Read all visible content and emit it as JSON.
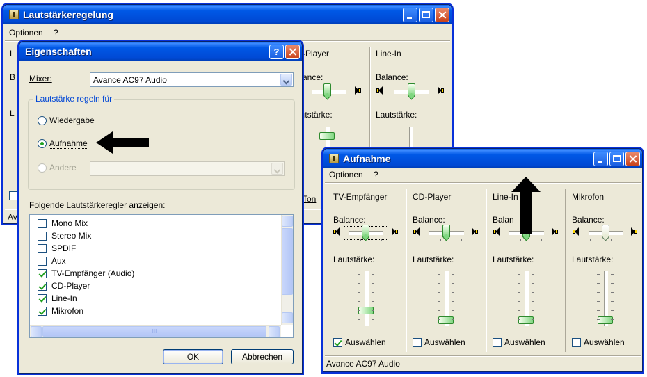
{
  "mixer_window": {
    "title": "Lautstärkeregelung",
    "menu": [
      "Optionen",
      "?"
    ],
    "partial_labels": {
      "c1": "L",
      "c2": "B",
      "c3": "L",
      "cd_player": "-Player",
      "line_in": "Line-In",
      "balance_part": "ance:",
      "balance": "Balance:",
      "lautst_part": "ıtstärke:",
      "lautst": "Lautstärke:",
      "ton": "Ton",
      "av": "Av"
    }
  },
  "eigenschaften": {
    "title": "Eigenschaften",
    "mixer_label": "Mixer:",
    "mixer_value": "Avance AC97 Audio",
    "group_label": "Lautstärke regeln für",
    "radio_options": [
      {
        "label": "Wiedergabe",
        "selected": false,
        "enabled": true
      },
      {
        "label": "Aufnahme",
        "selected": true,
        "enabled": true
      },
      {
        "label": "Andere",
        "selected": false,
        "enabled": false
      }
    ],
    "list_label": "Folgende Lautstärkeregler anzeigen:",
    "list_items": [
      {
        "label": "Mono Mix",
        "checked": false
      },
      {
        "label": "Stereo Mix",
        "checked": false
      },
      {
        "label": "SPDIF",
        "checked": false
      },
      {
        "label": "Aux",
        "checked": false
      },
      {
        "label": "TV-Empfänger (Audio)",
        "checked": true
      },
      {
        "label": "CD-Player",
        "checked": true
      },
      {
        "label": "Line-In",
        "checked": true
      },
      {
        "label": "Mikrofon",
        "checked": true
      }
    ],
    "scroll_grip": "III",
    "ok_label": "OK",
    "cancel_label": "Abbrechen"
  },
  "aufnahme": {
    "title": "Aufnahme",
    "menu": [
      "Optionen",
      "?"
    ],
    "columns": [
      {
        "name": "TV-Empfänger",
        "balance_label": "Balance:",
        "volume_label": "Lautstärke:",
        "select_label": "Auswählen",
        "selected": true
      },
      {
        "name": "CD-Player",
        "balance_label": "Balance:",
        "volume_label": "Lautstärke:",
        "select_label": "Auswählen",
        "selected": false
      },
      {
        "name": "Line-In",
        "balance_label": "Balan",
        "volume_label": "Lautstärke:",
        "select_label": "Auswählen",
        "selected": false
      },
      {
        "name": "Mikrofon",
        "balance_label": "Balance:",
        "volume_label": "Lautstärke:",
        "select_label": "Auswählen",
        "selected": false
      }
    ],
    "status": "Avance AC97 Audio"
  },
  "colors": {
    "xp_blue": "#0054e3",
    "face": "#ece9d8",
    "check_green": "#21a121"
  }
}
